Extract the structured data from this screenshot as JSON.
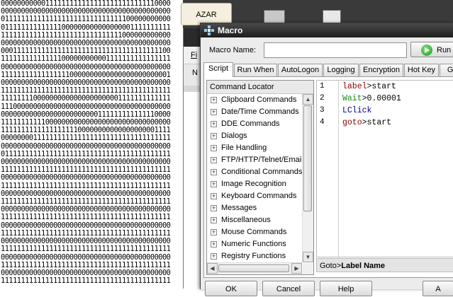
{
  "background_text": {
    "binary_lines": [
      "000000000001111111111111111111111111110000",
      "000000000000000000000000000000000000000000",
      "011111111111111111111111111111100000000000",
      "011111111111111000000000000000001111111111",
      "111111111111111111111111111111000000000000",
      "000000000000000000000000000000000000000000",
      "000111111111111111111111111111111111111100",
      "111111111111111000000000001111111111111111",
      "000000000000000000000000000000000000000000",
      "111111111111111110000000000000000000000001",
      "000000000000000000000000000000000000000000",
      "111111111111111111111111111111111111111111",
      "111111110000000000000000000001111111111111",
      "111000000000000000000000000000000000000000",
      "000000000000000000000000111111111111110000",
      "111111111110000000000000000000000000000000",
      "111111111111111111100000000000000000001111",
      "000000001111111111111111111111111111111111",
      "000000000000000000000000000000000000000000",
      "011111111111111111111111111111111111111111",
      "000000000000000000000000000000000000000000",
      "111111111111111111111111111111111111111111",
      "000000000000000000000000000000000000000000",
      "111111111111111111111111111111111111111111",
      "000000000000000000000000000000000000000000",
      "111111111111111111111111111111111111111111",
      "000000000000000000000000000000000000000000",
      "111111111111111111111111111111111111111111",
      "000000000000000000000000000000000000000000",
      "111111111111111111111111111111111111111111",
      "000000000000000000000000000000000000000000",
      "111111111111111111111111111111111111111111",
      "000000000000000000000000000000000000000000",
      "111111111111111111111111111111111111111111",
      "000000000000000000000000000000000000000000",
      "111111111111111111111111111111111111111111"
    ]
  },
  "background_app": {
    "button_label": "AZAR",
    "menu_label": "Fi",
    "tab_label": "N"
  },
  "macro_window": {
    "title": "Macro",
    "name_label": "Macro Name:",
    "name_value": "",
    "run_label": "Run",
    "tabs": [
      {
        "label": "Script",
        "active": true
      },
      {
        "label": "Run When"
      },
      {
        "label": "AutoLogon"
      },
      {
        "label": "Logging"
      },
      {
        "label": "Encryption"
      },
      {
        "label": "Hot Key"
      },
      {
        "label": "Gro"
      }
    ],
    "locator": {
      "header": "Command Locator",
      "items": [
        "Clipboard Commands",
        "Date/Time Commands",
        "DDE Commands",
        "Dialogs",
        "File Handling",
        "FTP/HTTP/Telnet/Email",
        "Conditional Commands",
        "Image Recognition",
        "Keyboard Commands",
        "Messages",
        "Miscellaneous",
        "Mouse Commands",
        "Numeric Functions",
        "Registry Functions"
      ]
    },
    "script_lines": [
      {
        "num": "1",
        "cmd": "label",
        "rest": ">start",
        "cls": "kw"
      },
      {
        "num": "2",
        "cmd": "Wait",
        "rest": ">0.00001",
        "cls": "kg"
      },
      {
        "num": "3",
        "cmd": "LClick",
        "rest": "",
        "cls": "kb"
      },
      {
        "num": "4",
        "cmd": "goto",
        "rest": ">start",
        "cls": "kw"
      }
    ],
    "status": {
      "prefix": "Goto>",
      "bold": "Label Name"
    },
    "buttons": {
      "ok": "OK",
      "cancel": "Cancel",
      "help": "Help",
      "extra": "A"
    }
  }
}
